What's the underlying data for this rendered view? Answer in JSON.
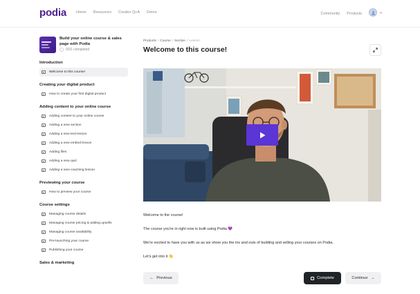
{
  "nav": {
    "logo": "podia",
    "links": [
      "Home",
      "Resources",
      "Creator Q+A",
      "Demo"
    ],
    "right_links": [
      "Community",
      "Products"
    ],
    "avatar_icon": "user-avatar-icon"
  },
  "sidebar": {
    "course_title": "Build your online course & sales page with Podia",
    "progress_text": "0/31 completed",
    "sections": [
      {
        "title": "Introduction",
        "lessons": [
          {
            "label": "Welcome to this course!",
            "active": true
          }
        ]
      },
      {
        "title": "Creating your digital product",
        "lessons": [
          {
            "label": "How to create your first digital product"
          }
        ]
      },
      {
        "title": "Adding content to your online course",
        "lessons": [
          {
            "label": "Adding content to your online course"
          },
          {
            "label": "Adding a new section"
          },
          {
            "label": "Adding a new text lesson"
          },
          {
            "label": "Adding a new embed lesson"
          },
          {
            "label": "Adding files"
          },
          {
            "label": "Adding a new quiz"
          },
          {
            "label": "Adding a new coaching lesson"
          }
        ]
      },
      {
        "title": "Previewing your course",
        "lessons": [
          {
            "label": "How to preview your course"
          }
        ]
      },
      {
        "title": "Course settings",
        "lessons": [
          {
            "label": "Managing course details"
          },
          {
            "label": "Managing course pricing & adding upsells"
          },
          {
            "label": "Managing course availability"
          },
          {
            "label": "Pre-launching your course"
          },
          {
            "label": "Publishing your course"
          }
        ]
      },
      {
        "title": "Sales & marketing",
        "lessons": []
      }
    ]
  },
  "main": {
    "breadcrumb": [
      "Products",
      "Course",
      "Section",
      "Lesson"
    ],
    "title": "Welcome to this course!",
    "paragraphs": [
      "Welcome to the course!",
      "The course you're in right now is built using Podia 💜",
      "We're excited to have you with us as we show you the ins and outs of building and selling your courses on Podia.",
      "Let's get into it 👋"
    ],
    "buttons": {
      "previous": "Previous",
      "complete": "Complete",
      "continue": "Continue"
    }
  },
  "colors": {
    "brand": "#4b1f8f",
    "play_button": "#5b35d5",
    "complete_button": "#1f2428"
  }
}
